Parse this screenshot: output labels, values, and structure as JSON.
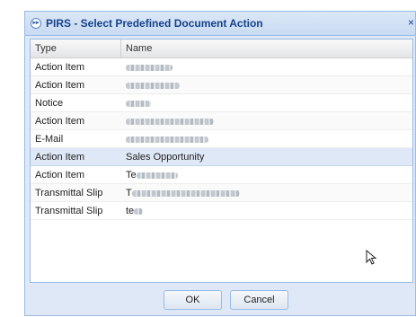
{
  "dialog": {
    "title": "PIRS - Select Predefined Document Action",
    "close_glyph": "×"
  },
  "grid": {
    "columns": [
      "Type",
      "Name"
    ],
    "rows": [
      {
        "type": "Action Item",
        "name": "",
        "blurred": true
      },
      {
        "type": "Action Item",
        "name": "",
        "blurred": true
      },
      {
        "type": "Notice",
        "name": "",
        "blurred": true
      },
      {
        "type": "Action Item",
        "name": "",
        "blurred": true
      },
      {
        "type": "E-Mail",
        "name": "",
        "blurred": true
      },
      {
        "type": "Action Item",
        "name": "Sales Opportunity",
        "blurred": false,
        "selected": true
      },
      {
        "type": "Action Item",
        "name": "Te",
        "blurred": true
      },
      {
        "type": "Transmittal Slip",
        "name": "T",
        "blurred": true
      },
      {
        "type": "Transmittal Slip",
        "name": "te",
        "blurred": true
      }
    ]
  },
  "buttons": {
    "ok_label": "OK",
    "cancel_label": "Cancel"
  },
  "colors": {
    "title_text": "#15428b",
    "selected_row": "#dfe8f6",
    "dialog_bg": "#dfe8f6",
    "border": "#99bbe8"
  },
  "icons": [
    "window-app-icon",
    "close-icon",
    "mouse-cursor-icon"
  ]
}
